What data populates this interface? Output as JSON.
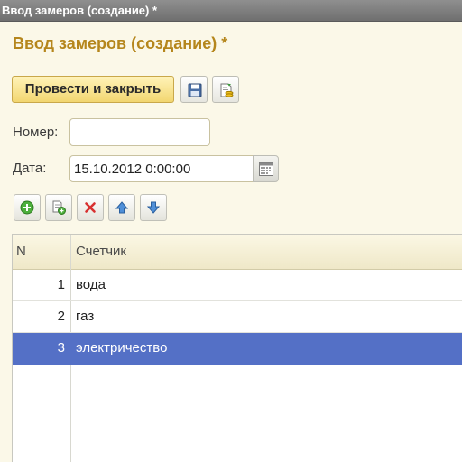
{
  "window": {
    "title": "Ввод замеров (создание) *"
  },
  "form": {
    "title": "Ввод замеров (создание) *"
  },
  "toolbar": {
    "post_and_close_label": "Провести и закрыть",
    "icons": [
      "save-icon",
      "post-document-icon"
    ]
  },
  "fields": {
    "number_label": "Номер:",
    "number_value": "",
    "date_label": "Дата:",
    "date_value": "15.10.2012  0:00:00"
  },
  "table_toolbar": {
    "icons": [
      "add-icon",
      "copy-icon",
      "delete-icon",
      "move-up-icon",
      "move-down-icon"
    ]
  },
  "table": {
    "columns": [
      "N",
      "Счетчик"
    ],
    "rows": [
      {
        "n": "1",
        "meter": "вода"
      },
      {
        "n": "2",
        "meter": "газ"
      },
      {
        "n": "3",
        "meter": "электричество"
      }
    ],
    "selected_row": 3
  },
  "colors": {
    "accent_title": "#b5861c",
    "selection": "#5470c6",
    "background": "#fbf8e8"
  }
}
